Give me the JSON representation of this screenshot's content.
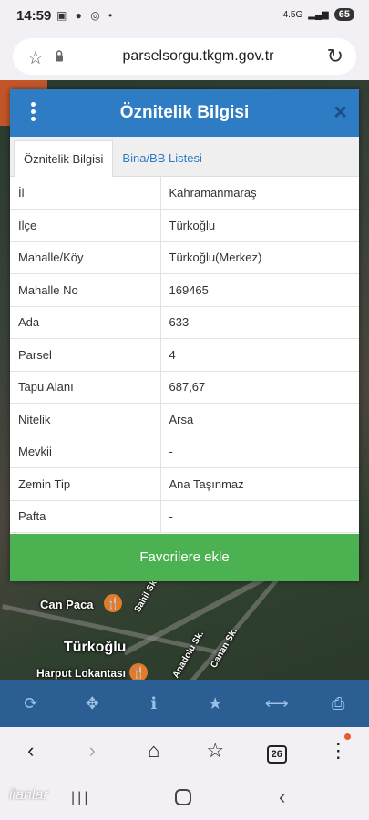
{
  "status": {
    "time": "14:59",
    "network": "4.5G",
    "battery": "65"
  },
  "browser": {
    "url": "parselsorgu.tkgm.gov.tr",
    "tab_count": "26"
  },
  "modal": {
    "title": "Öznitelik Bilgisi",
    "tabs": [
      {
        "label": "Öznitelik Bilgisi"
      },
      {
        "label": "Bina/BB Listesi"
      }
    ],
    "rows": [
      {
        "key": "İl",
        "value": "Kahramanmaraş"
      },
      {
        "key": "İlçe",
        "value": "Türkoğlu"
      },
      {
        "key": "Mahalle/Köy",
        "value": "Türkoğlu(Merkez)"
      },
      {
        "key": "Mahalle No",
        "value": "169465"
      },
      {
        "key": "Ada",
        "value": "633"
      },
      {
        "key": "Parsel",
        "value": "4"
      },
      {
        "key": "Tapu Alanı",
        "value": "687,67"
      },
      {
        "key": "Nitelik",
        "value": "Arsa"
      },
      {
        "key": "Mevkii",
        "value": "-"
      },
      {
        "key": "Zemin Tip",
        "value": "Ana Taşınmaz"
      },
      {
        "key": "Pafta",
        "value": "-"
      }
    ],
    "favorite_label": "Favorilere ekle"
  },
  "map": {
    "labels": {
      "can_paca": "Can Paca",
      "turkoglu": "Türkoğlu",
      "harput": "Harput Lokantası",
      "sahil": "Sahil Sk.",
      "canan": "Canan Sk.",
      "anadolu": "Anadolu Sk."
    }
  },
  "watermark": "ilanlar",
  "colors": {
    "header": "#2d7cc4",
    "button": "#4cb150",
    "toolbar": "#2b5f94"
  }
}
